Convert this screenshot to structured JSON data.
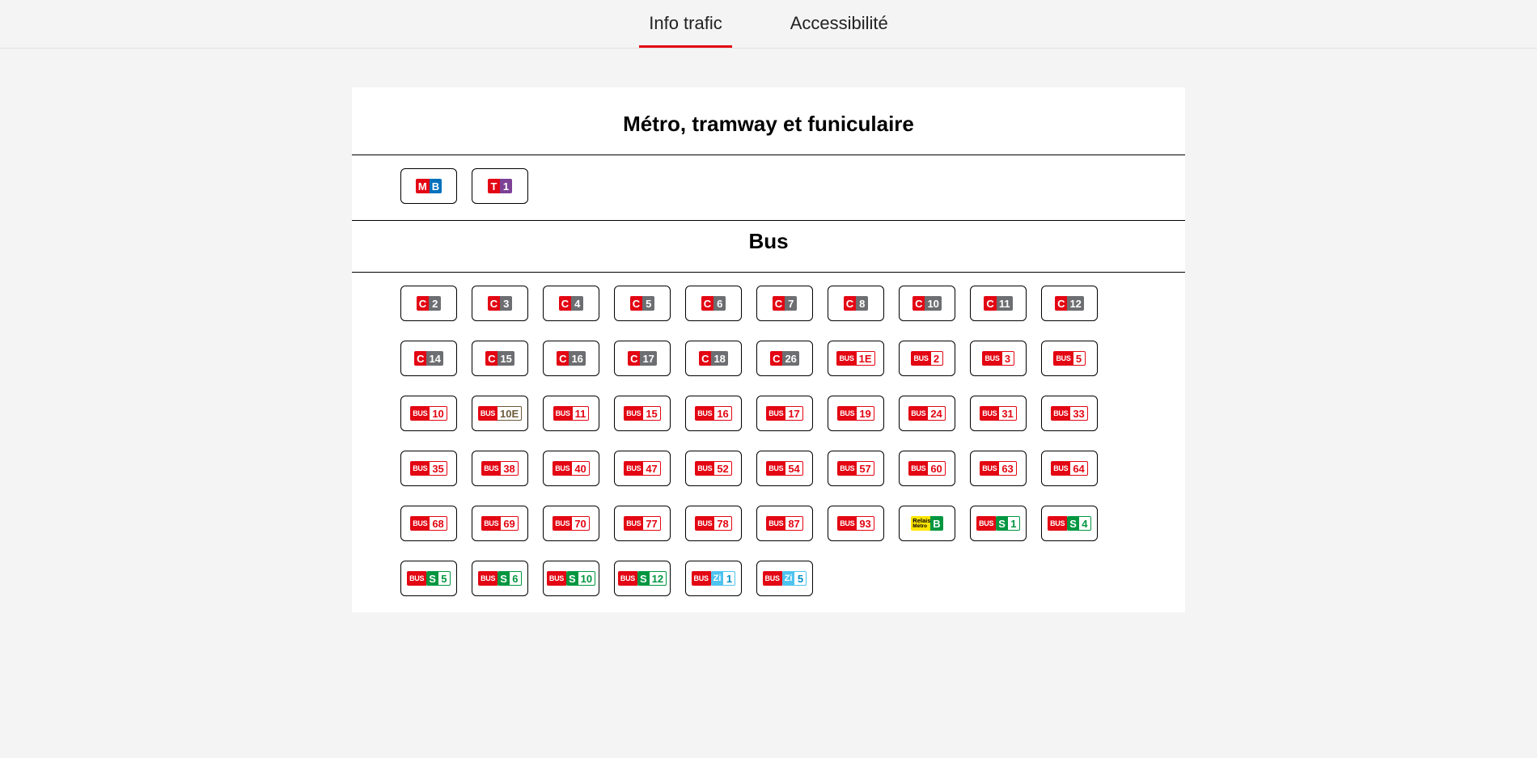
{
  "tabs": {
    "info": "Info trafic",
    "access": "Accessibilité"
  },
  "titles": {
    "metro": "Métro, tramway et funiculaire",
    "bus": "Bus"
  },
  "metro_lines": [
    {
      "pref": "M",
      "num": "B",
      "pref_cls": "pref-m",
      "num_cls": "num-mb",
      "name": "metro-b"
    },
    {
      "pref": "T",
      "num": "1",
      "pref_cls": "pref-t",
      "num_cls": "num-t1",
      "name": "tram-1"
    }
  ],
  "bus_lines": [
    {
      "type": "c",
      "pref": "C",
      "num": "2"
    },
    {
      "type": "c",
      "pref": "C",
      "num": "3"
    },
    {
      "type": "c",
      "pref": "C",
      "num": "4"
    },
    {
      "type": "c",
      "pref": "C",
      "num": "5"
    },
    {
      "type": "c",
      "pref": "C",
      "num": "6"
    },
    {
      "type": "c",
      "pref": "C",
      "num": "7"
    },
    {
      "type": "c",
      "pref": "C",
      "num": "8"
    },
    {
      "type": "c",
      "pref": "C",
      "num": "10"
    },
    {
      "type": "c",
      "pref": "C",
      "num": "11"
    },
    {
      "type": "c",
      "pref": "C",
      "num": "12"
    },
    {
      "type": "c",
      "pref": "C",
      "num": "14"
    },
    {
      "type": "c",
      "pref": "C",
      "num": "15"
    },
    {
      "type": "c",
      "pref": "C",
      "num": "16"
    },
    {
      "type": "c",
      "pref": "C",
      "num": "17"
    },
    {
      "type": "c",
      "pref": "C",
      "num": "18"
    },
    {
      "type": "c",
      "pref": "C",
      "num": "26"
    },
    {
      "type": "bus",
      "pref": "BUS",
      "num": "1E"
    },
    {
      "type": "bus",
      "pref": "BUS",
      "num": "2"
    },
    {
      "type": "bus",
      "pref": "BUS",
      "num": "3"
    },
    {
      "type": "bus",
      "pref": "BUS",
      "num": "5"
    },
    {
      "type": "bus",
      "pref": "BUS",
      "num": "10"
    },
    {
      "type": "bus-brown",
      "pref": "BUS",
      "num": "10E"
    },
    {
      "type": "bus",
      "pref": "BUS",
      "num": "11"
    },
    {
      "type": "bus",
      "pref": "BUS",
      "num": "15"
    },
    {
      "type": "bus",
      "pref": "BUS",
      "num": "16"
    },
    {
      "type": "bus",
      "pref": "BUS",
      "num": "17"
    },
    {
      "type": "bus",
      "pref": "BUS",
      "num": "19"
    },
    {
      "type": "bus",
      "pref": "BUS",
      "num": "24"
    },
    {
      "type": "bus",
      "pref": "BUS",
      "num": "31"
    },
    {
      "type": "bus",
      "pref": "BUS",
      "num": "33"
    },
    {
      "type": "bus",
      "pref": "BUS",
      "num": "35"
    },
    {
      "type": "bus",
      "pref": "BUS",
      "num": "38"
    },
    {
      "type": "bus",
      "pref": "BUS",
      "num": "40"
    },
    {
      "type": "bus",
      "pref": "BUS",
      "num": "47"
    },
    {
      "type": "bus",
      "pref": "BUS",
      "num": "52"
    },
    {
      "type": "bus",
      "pref": "BUS",
      "num": "54"
    },
    {
      "type": "bus",
      "pref": "BUS",
      "num": "57"
    },
    {
      "type": "bus",
      "pref": "BUS",
      "num": "60"
    },
    {
      "type": "bus",
      "pref": "BUS",
      "num": "63"
    },
    {
      "type": "bus",
      "pref": "BUS",
      "num": "64"
    },
    {
      "type": "bus",
      "pref": "BUS",
      "num": "68"
    },
    {
      "type": "bus",
      "pref": "BUS",
      "num": "69"
    },
    {
      "type": "bus",
      "pref": "BUS",
      "num": "70"
    },
    {
      "type": "bus",
      "pref": "BUS",
      "num": "77"
    },
    {
      "type": "bus",
      "pref": "BUS",
      "num": "78"
    },
    {
      "type": "bus",
      "pref": "BUS",
      "num": "87"
    },
    {
      "type": "bus",
      "pref": "BUS",
      "num": "93"
    },
    {
      "type": "relais",
      "pref1": "Relais",
      "pref2": "Métro",
      "num": "B"
    },
    {
      "type": "s",
      "pref": "BUS",
      "mid": "S",
      "num": "1"
    },
    {
      "type": "s",
      "pref": "BUS",
      "mid": "S",
      "num": "4"
    },
    {
      "type": "s",
      "pref": "BUS",
      "mid": "S",
      "num": "5"
    },
    {
      "type": "s",
      "pref": "BUS",
      "mid": "S",
      "num": "6"
    },
    {
      "type": "s",
      "pref": "BUS",
      "mid": "S",
      "num": "10"
    },
    {
      "type": "s",
      "pref": "BUS",
      "mid": "S",
      "num": "12"
    },
    {
      "type": "zi",
      "pref": "BUS",
      "mid": "Zi",
      "num": "1"
    },
    {
      "type": "zi",
      "pref": "BUS",
      "mid": "Zi",
      "num": "5"
    }
  ]
}
